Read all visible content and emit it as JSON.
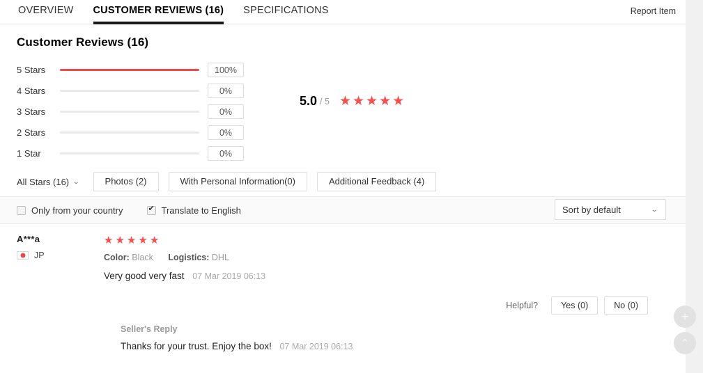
{
  "tabs": [
    {
      "label": "OVERVIEW",
      "active": false
    },
    {
      "label": "CUSTOMER REVIEWS (16)",
      "active": true
    },
    {
      "label": "SPECIFICATIONS",
      "active": false
    }
  ],
  "header": {
    "report_item_label": "Report Item"
  },
  "section": {
    "title": "Customer Reviews (16)"
  },
  "chart_data": {
    "type": "bar",
    "title": "Customer Reviews (16)",
    "orientation": "horizontal",
    "categories": [
      "5 Stars",
      "4 Stars",
      "3 Stars",
      "2 Stars",
      "1 Star"
    ],
    "values": [
      100,
      0,
      0,
      0,
      0
    ],
    "value_labels": [
      "100%",
      "0%",
      "0%",
      "0%",
      "0%"
    ],
    "xlabel": "",
    "ylabel": "",
    "xlim": [
      0,
      100
    ],
    "grid": false,
    "legend": "none",
    "bar_color": "#e8494c",
    "track_color": "#e9e9e9"
  },
  "rating_summary": {
    "score": "5.0",
    "out_of": "/ 5",
    "stars_filled": 5,
    "star_glyph": "★",
    "star_color": "#f5504e"
  },
  "filters": {
    "all_stars_label": "All Stars (16)",
    "chips": [
      {
        "label": "Photos (2)"
      },
      {
        "label": "With Personal Information(0)"
      },
      {
        "label": "Additional Feedback (4)"
      }
    ]
  },
  "options": {
    "only_country": {
      "label": "Only from your country",
      "checked": false
    },
    "translate": {
      "label": "Translate to English",
      "checked": true
    },
    "sort": {
      "value": "Sort by default"
    }
  },
  "reviews": [
    {
      "name": "A***a",
      "country_code": "JP",
      "country_flag": "japan-flag-icon",
      "stars": 5,
      "attributes": [
        {
          "key": "Color:",
          "value": "Black"
        },
        {
          "key": "Logistics:",
          "value": "DHL"
        }
      ],
      "text": "Very good very fast",
      "date": "07 Mar 2019 06:13",
      "helpful": {
        "label": "Helpful?",
        "yes_label": "Yes (0)",
        "no_label": "No (0)"
      },
      "seller_reply": {
        "title": "Seller's Reply",
        "text": "Thanks for your trust. Enjoy the box!",
        "date": "07 Mar 2019 06:13"
      }
    }
  ],
  "floating_buttons": {
    "add_label": "+",
    "scroll_top_label": "⌃"
  }
}
